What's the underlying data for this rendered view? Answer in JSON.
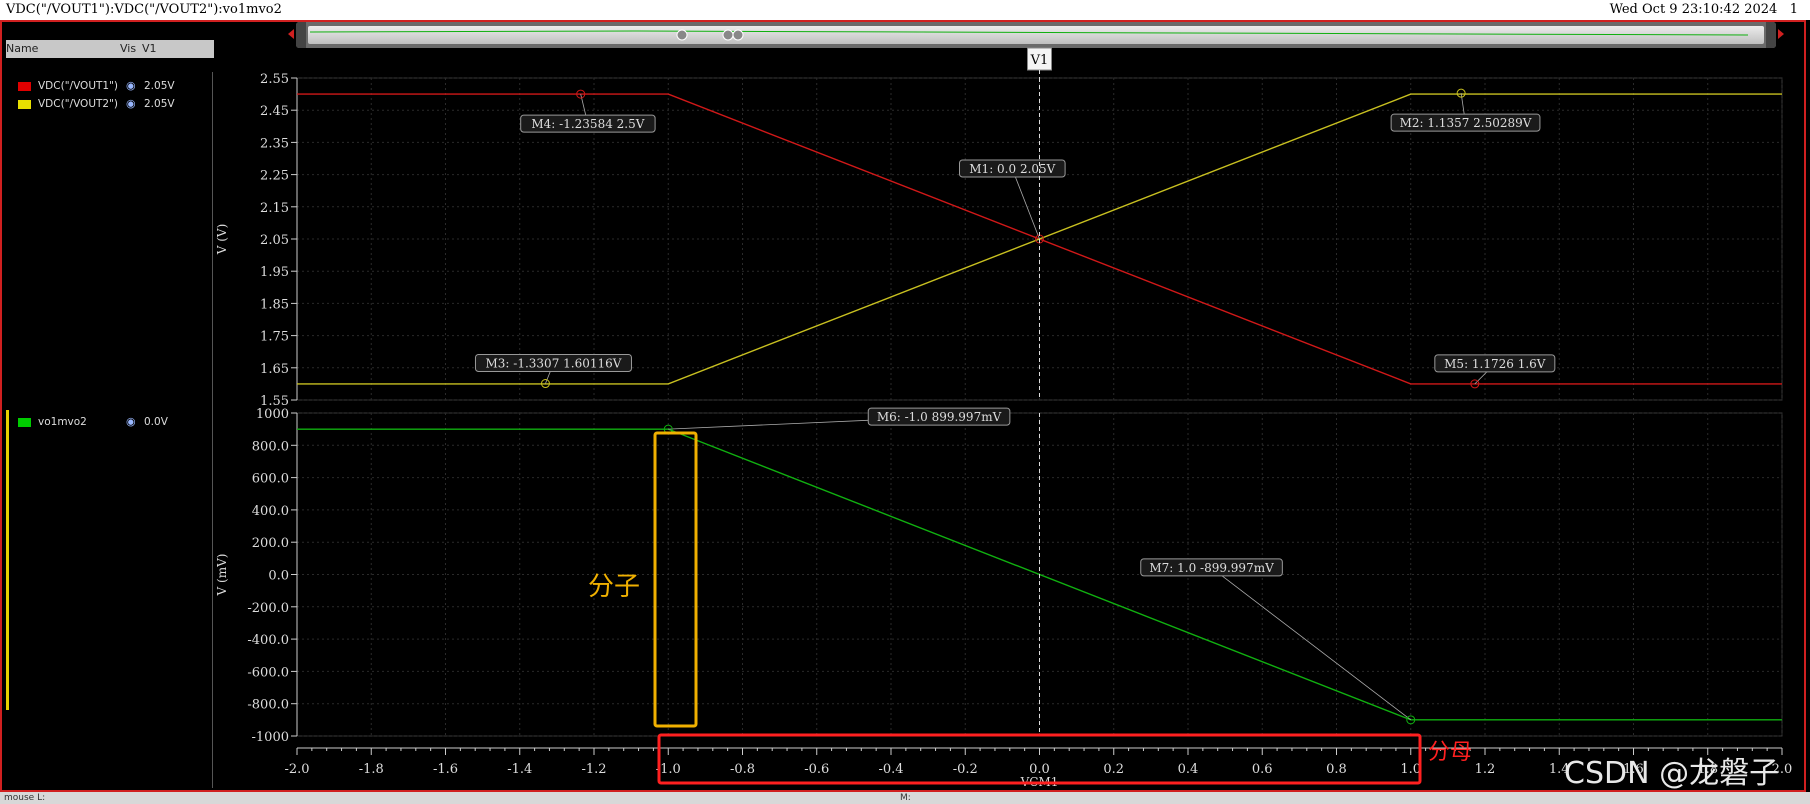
{
  "window": {
    "title": "VDC(\"/VOUT1\"):VDC(\"/VOUT2\"):vo1mvo2",
    "datetime": "Wed Oct 9 23:10:42 2024",
    "page": "1"
  },
  "legend": {
    "headers": {
      "name": "Name",
      "vis": "Vis",
      "value": "V1"
    },
    "upper": [
      {
        "name": "VDC(\"/VOUT1\")",
        "color": "#e00000",
        "value": "2.05V"
      },
      {
        "name": "VDC(\"/VOUT2\")",
        "color": "#e8e000",
        "value": "2.05V"
      }
    ],
    "lower": [
      {
        "name": "vo1mvo2",
        "color": "#00cc00",
        "value": "0.0V"
      }
    ]
  },
  "cursor": {
    "label": "V1",
    "x": 0.0
  },
  "colors": {
    "vout1": "#d01818",
    "vout2": "#c8c020",
    "vo1mvo2": "#10b010",
    "numerator_box": "#f0b000",
    "denominator_box": "#ff2020"
  },
  "chart_data": [
    {
      "type": "line",
      "ylabel": "V (V)",
      "xlim": [
        -2.0,
        2.0
      ],
      "ylim": [
        1.55,
        2.55
      ],
      "yticks": [
        "2.55",
        "2.45",
        "2.35",
        "2.25",
        "2.15",
        "2.05",
        "1.95",
        "1.85",
        "1.75",
        "1.65",
        "1.55"
      ],
      "series": [
        {
          "name": "VDC(\"/VOUT1\")",
          "x": [
            -2.0,
            -1.0,
            1.0,
            2.0
          ],
          "y": [
            2.5,
            2.5,
            1.6,
            1.6
          ]
        },
        {
          "name": "VDC(\"/VOUT2\")",
          "x": [
            -2.0,
            -1.0,
            1.0,
            2.0
          ],
          "y": [
            1.6,
            1.6,
            2.5,
            2.5
          ]
        }
      ],
      "markers": [
        {
          "label": "M4: -1.23584 2.5V",
          "x": -1.23584,
          "y": 2.5,
          "series": 0
        },
        {
          "label": "M2: 1.1357 2.50289V",
          "x": 1.1357,
          "y": 2.50289,
          "series": 1
        },
        {
          "label": "M1: 0.0 2.05V",
          "x": 0.0,
          "y": 2.05,
          "series": 0
        },
        {
          "label": "M3: -1.3307 1.60116V",
          "x": -1.3307,
          "y": 1.60116,
          "series": 1
        },
        {
          "label": "M5: 1.1726 1.6V",
          "x": 1.1726,
          "y": 1.6,
          "series": 0
        }
      ]
    },
    {
      "type": "line",
      "xlabel": "VCM1",
      "ylabel": "V (mV)",
      "xlim": [
        -2.0,
        2.0
      ],
      "ylim": [
        -1000,
        1000
      ],
      "yticks": [
        "1000",
        "800.0",
        "600.0",
        "400.0",
        "200.0",
        "0.0",
        "-200.0",
        "-400.0",
        "-600.0",
        "-800.0",
        "-1000"
      ],
      "xticks": [
        "-2.0",
        "-1.8",
        "-1.6",
        "-1.4",
        "-1.2",
        "-1.0",
        "-0.8",
        "-0.6",
        "-0.4",
        "-0.2",
        "0.0",
        "0.2",
        "0.4",
        "0.6",
        "0.8",
        "1.0",
        "1.2",
        "1.4",
        "1.6",
        "1.8",
        "2.0"
      ],
      "series": [
        {
          "name": "vo1mvo2",
          "x": [
            -2.0,
            -1.0,
            1.0,
            2.0
          ],
          "y": [
            900,
            900,
            -900,
            -900
          ]
        }
      ],
      "markers": [
        {
          "label": "M6: -1.0 899.997mV",
          "x": -1.0,
          "y": 899.997,
          "series": 0
        },
        {
          "label": "M7: 1.0 -899.997mV",
          "x": 1.0,
          "y": -899.997,
          "series": 0
        }
      ]
    }
  ],
  "annotations": {
    "numerator": "分子",
    "denominator": "分母"
  },
  "watermark": "CSDN @龙磐子",
  "status": {
    "left": "mouse L:",
    "mid": "M:"
  }
}
